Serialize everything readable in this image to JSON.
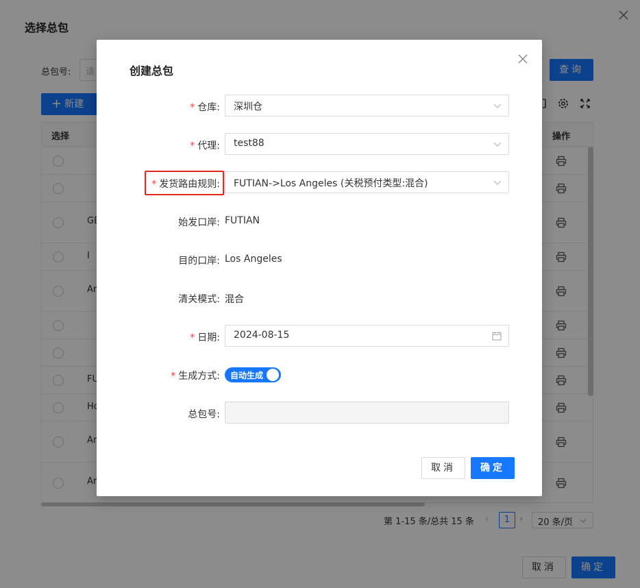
{
  "page": {
    "title": "选择总包",
    "filter_label": "总包号:",
    "filter_placeholder": "请",
    "query_button": "查询",
    "new_button": "新建",
    "table": {
      "col_select": "选择",
      "col_action": "操作",
      "rows": [
        "",
        "",
        "GE",
        "I",
        "Ar",
        "",
        "",
        "FU",
        "Ho",
        "Ar",
        "Ar"
      ]
    },
    "pager": {
      "summary": "第 1-15 条/总共 15 条",
      "current_page": "1",
      "page_size": "20 条/页"
    },
    "cancel_button": "取消",
    "ok_button": "确定"
  },
  "modal": {
    "title": "创建总包",
    "fields": {
      "warehouse": {
        "label": "仓库",
        "value": "深圳仓",
        "required": true
      },
      "agent": {
        "label": "代理",
        "value": "test88",
        "required": true
      },
      "route_rule": {
        "label": "发货路由规则",
        "value": "FUTIAN->Los Angeles (关税预付类型:混合)",
        "required": true
      },
      "origin_port": {
        "label": "始发口岸",
        "value": "FUTIAN"
      },
      "dest_port": {
        "label": "目的口岸",
        "value": "Los Angeles"
      },
      "customs_mode": {
        "label": "清关模式",
        "value": "混合"
      },
      "date": {
        "label": "日期",
        "value": "2024-08-15",
        "required": true
      },
      "gen_mode": {
        "label": "生成方式",
        "toggle_text": "自动生成",
        "on": true,
        "required": true
      },
      "package_no": {
        "label": "总包号",
        "value": ""
      }
    },
    "label_colon": ":",
    "cancel_button": "取消",
    "ok_button": "确定"
  },
  "colors": {
    "primary": "#1677ff",
    "required": "#e84040",
    "highlight": "#e0281f"
  },
  "icons": [
    "close-icon",
    "plus-icon",
    "settings-icon",
    "fullscreen-icon",
    "column-icon",
    "print-icon",
    "chevron-down-icon",
    "calendar-icon",
    "chevron-left-icon",
    "chevron-right-icon"
  ]
}
